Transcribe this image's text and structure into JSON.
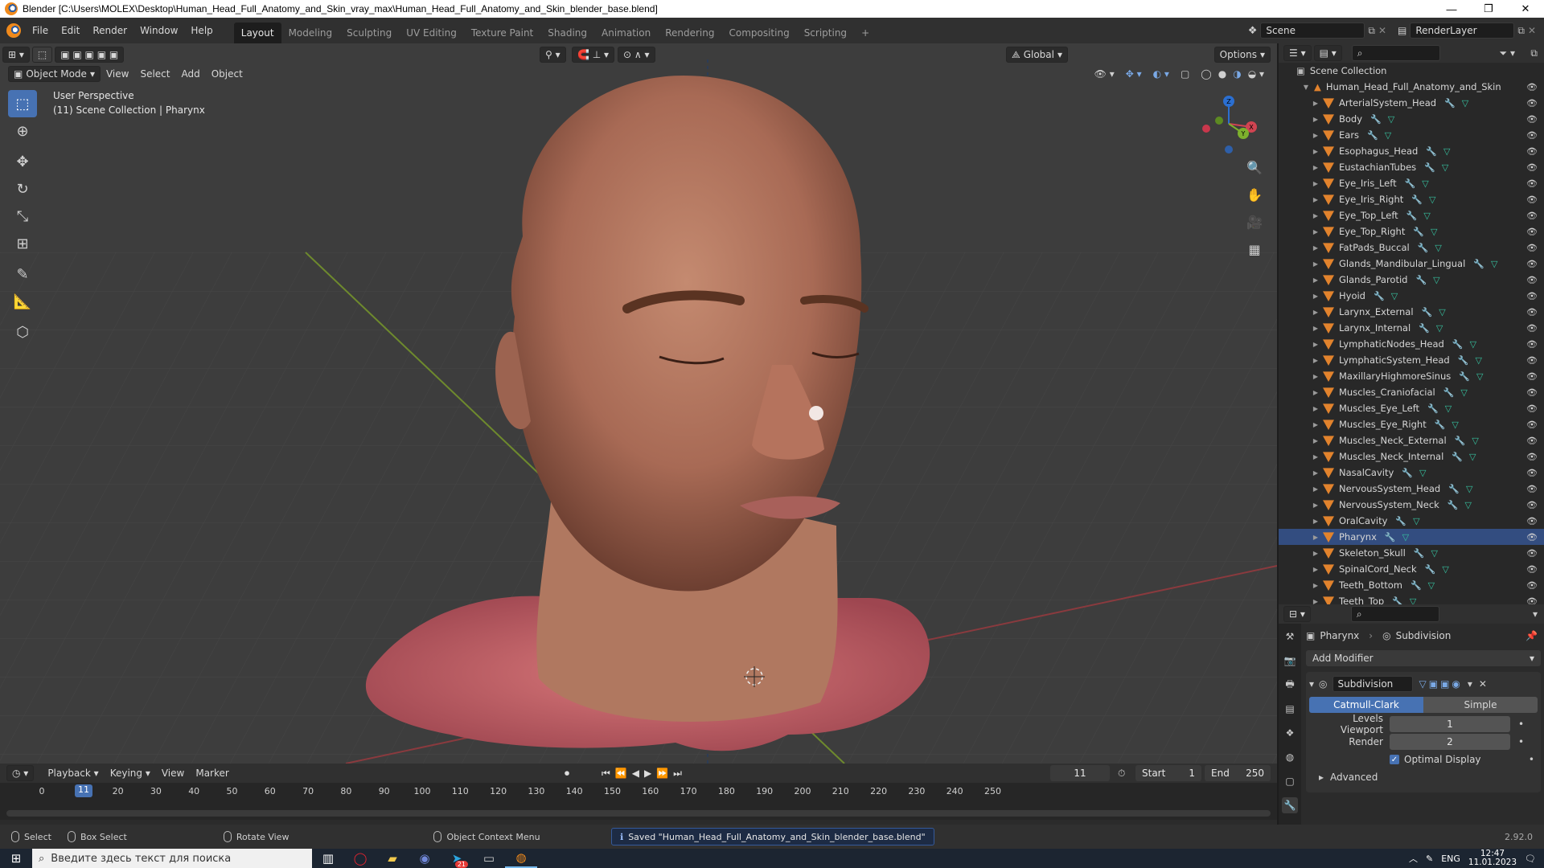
{
  "window": {
    "title": "Blender [C:\\Users\\MOLEX\\Desktop\\Human_Head_Full_Anatomy_and_Skin_vray_max\\Human_Head_Full_Anatomy_and_Skin_blender_base.blend]",
    "minimize": "—",
    "maximize": "❐",
    "close": "✕"
  },
  "menu": [
    "File",
    "Edit",
    "Render",
    "Window",
    "Help"
  ],
  "workspaces": [
    {
      "label": "Layout",
      "active": true
    },
    {
      "label": "Modeling"
    },
    {
      "label": "Sculpting"
    },
    {
      "label": "UV Editing"
    },
    {
      "label": "Texture Paint"
    },
    {
      "label": "Shading"
    },
    {
      "label": "Animation"
    },
    {
      "label": "Rendering"
    },
    {
      "label": "Compositing"
    },
    {
      "label": "Scripting"
    },
    {
      "label": "+"
    }
  ],
  "scene": "Scene",
  "render_layer": "RenderLayer",
  "viewport": {
    "mode": "Object Mode",
    "menus": [
      "View",
      "Select",
      "Add",
      "Object"
    ],
    "transform_orientation": "Global",
    "options": "Options",
    "info_line1": "User Perspective",
    "info_line2": "(11) Scene Collection | Pharynx",
    "gizmo_labels": {
      "x": "X",
      "y": "Y",
      "z": "Z"
    }
  },
  "timeline": {
    "menus": [
      "Playback",
      "Keying",
      "View",
      "Marker"
    ],
    "current_frame": "11",
    "start_label": "Start",
    "start": "1",
    "end_label": "End",
    "end": "250",
    "ticks": [
      "0",
      "10",
      "20",
      "30",
      "40",
      "50",
      "60",
      "70",
      "80",
      "90",
      "100",
      "110",
      "120",
      "130",
      "140",
      "150",
      "160",
      "170",
      "180",
      "190",
      "200",
      "210",
      "220",
      "230",
      "240",
      "250"
    ]
  },
  "outliner": {
    "root": "Scene Collection",
    "collection": "Human_Head_Full_Anatomy_and_Skin",
    "items": [
      "ArterialSystem_Head",
      "Body",
      "Ears",
      "Esophagus_Head",
      "EustachianTubes",
      "Eye_Iris_Left",
      "Eye_Iris_Right",
      "Eye_Top_Left",
      "Eye_Top_Right",
      "FatPads_Buccal",
      "Glands_Mandibular_Lingual",
      "Glands_Parotid",
      "Hyoid",
      "Larynx_External",
      "Larynx_Internal",
      "LymphaticNodes_Head",
      "LymphaticSystem_Head",
      "MaxillaryHighmoreSinus",
      "Muscles_Craniofacial",
      "Muscles_Eye_Left",
      "Muscles_Eye_Right",
      "Muscles_Neck_External",
      "Muscles_Neck_Internal",
      "NasalCavity",
      "NervousSystem_Head",
      "NervousSystem_Neck",
      "OralCavity",
      "Pharynx",
      "Skeleton_Skull",
      "SpinalCord_Neck",
      "Teeth_Bottom",
      "Teeth_Top"
    ],
    "selected": "Pharynx"
  },
  "properties": {
    "object": "Pharynx",
    "modifier_tab": "Subdivision",
    "add_modifier": "Add Modifier",
    "modifier_name": "Subdivision",
    "catmull": "Catmull-Clark",
    "simple": "Simple",
    "levels_label": "Levels Viewport",
    "levels_value": "1",
    "render_label": "Render",
    "render_value": "2",
    "optimal_display": "Optimal Display",
    "advanced": "Advanced"
  },
  "status": {
    "select": "Select",
    "box_select": "Box Select",
    "rotate_view": "Rotate View",
    "context_menu": "Object Context Menu",
    "message": "Saved \"Human_Head_Full_Anatomy_and_Skin_blender_base.blend\"",
    "version": "2.92.0"
  },
  "taskbar": {
    "search_placeholder": "Введите здесь текст для поиска",
    "lang": "ENG",
    "time": "12:47",
    "date": "11.01.2023",
    "telegram_badge": "21"
  }
}
